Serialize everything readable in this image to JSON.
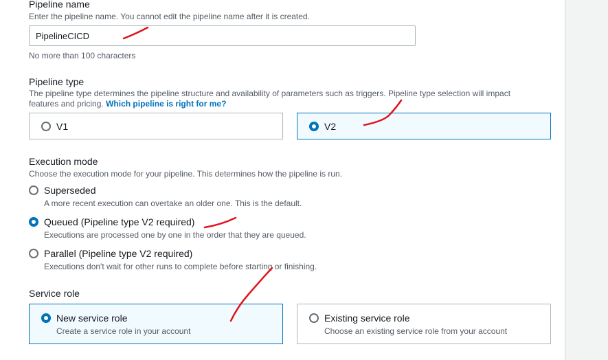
{
  "pipeline_name": {
    "label": "Pipeline name",
    "description": "Enter the pipeline name. You cannot edit the pipeline name after it is created.",
    "value": "PipelineCICD",
    "constraint": "No more than 100 characters"
  },
  "pipeline_type": {
    "label": "Pipeline type",
    "description": "The pipeline type determines the pipeline structure and availability of parameters such as triggers. Pipeline type selection will impact features and pricing.",
    "link": "Which pipeline is right for me?",
    "options": [
      {
        "label": "V1",
        "selected": false
      },
      {
        "label": "V2",
        "selected": true
      }
    ]
  },
  "execution_mode": {
    "label": "Execution mode",
    "description": "Choose the execution mode for your pipeline. This determines how the pipeline is run.",
    "options": [
      {
        "label": "Superseded",
        "description": "A more recent execution can overtake an older one. This is the default.",
        "selected": false
      },
      {
        "label": "Queued (Pipeline type V2 required)",
        "description": "Executions are processed one by one in the order that they are queued.",
        "selected": true
      },
      {
        "label": "Parallel (Pipeline type V2 required)",
        "description": "Executions don't wait for other runs to complete before starting or finishing.",
        "selected": false
      }
    ]
  },
  "service_role": {
    "label": "Service role",
    "options": [
      {
        "label": "New service role",
        "description": "Create a service role in your account",
        "selected": true
      },
      {
        "label": "Existing service role",
        "description": "Choose an existing service role from your account",
        "selected": false
      }
    ]
  },
  "colors": {
    "accent": "#0073bb",
    "annotation": "#e0141c",
    "selected_tile_bg": "#f1faff"
  }
}
